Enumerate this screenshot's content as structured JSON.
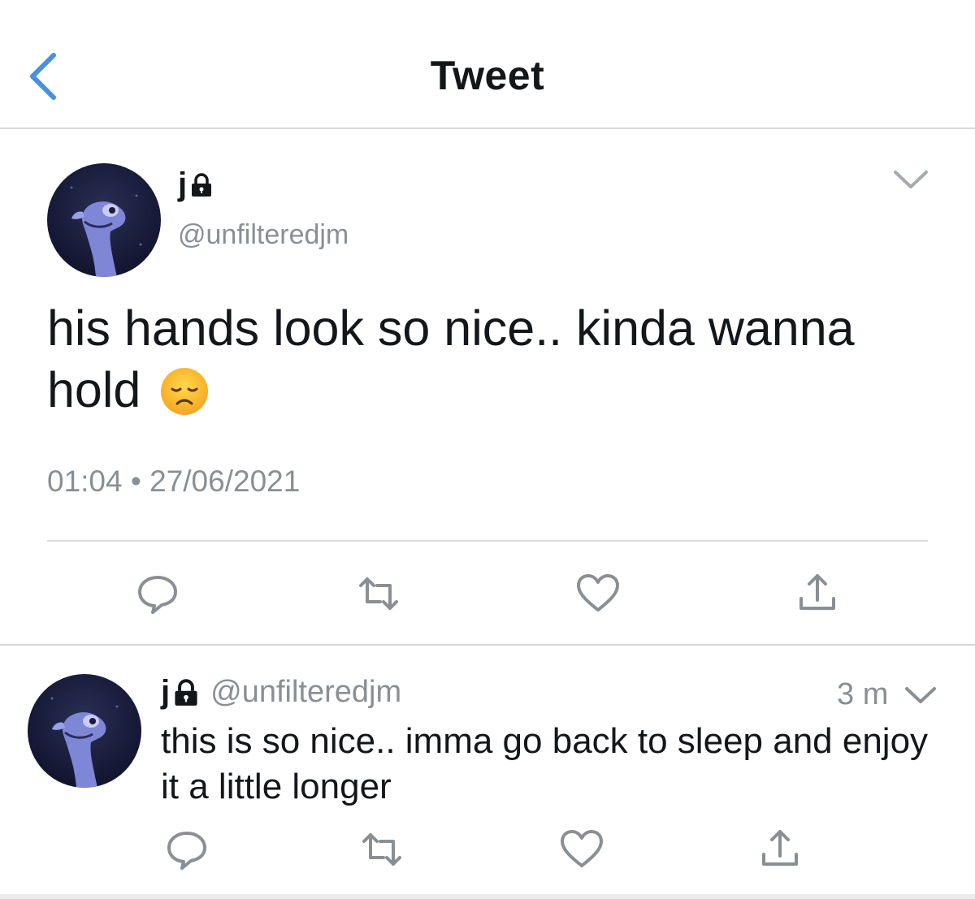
{
  "nav": {
    "title": "Tweet",
    "back_icon": "chevron-left-icon",
    "accent_color": "#4a90e2"
  },
  "tweet": {
    "display_name": "j",
    "protected_icon": "lock-icon",
    "handle": "@unfilteredjm",
    "text": "his hands look so nice.. kinda wanna hold",
    "emoji": "disappointed-face-emoji",
    "time": "01:04",
    "separator": "•",
    "date": "27/06/2021",
    "actions": [
      "reply-icon",
      "retweet-icon",
      "like-icon",
      "share-icon"
    ]
  },
  "reply": {
    "display_name": "j",
    "protected_icon": "lock-icon",
    "handle": "@unfilteredjm",
    "time_ago": "3 m",
    "text": "this is so nice.. imma go back to sleep and enjoy it a little longer",
    "actions": [
      "reply-icon",
      "retweet-icon",
      "like-icon",
      "share-icon"
    ]
  },
  "colors": {
    "text": "#14171a",
    "secondary": "#8a8f94",
    "icon": "#8a8f94",
    "divider": "#d8d8d8"
  }
}
